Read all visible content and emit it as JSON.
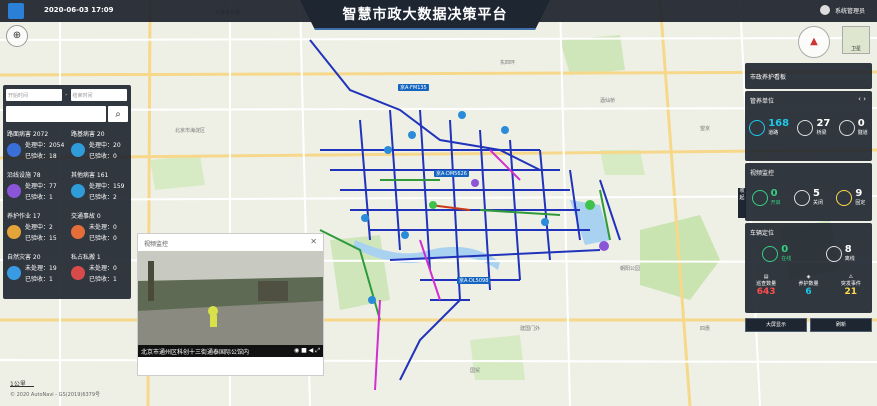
{
  "header": {
    "datetime": "2020-06-03 17:09",
    "title": "智慧市政大数据决策平台",
    "username": "系统管理员"
  },
  "filters": {
    "start_placeholder": "开始时间",
    "end_placeholder": "结束时间",
    "separator": "-"
  },
  "stats": [
    {
      "title": "路面病害 2072",
      "line1": "处理中：2054",
      "line2": "已验收：18",
      "color": "#3b6fd8"
    },
    {
      "title": "路基病害 20",
      "line1": "处理中：20",
      "line2": "已验收：0",
      "color": "#2f9bd9"
    },
    {
      "title": "沿线设施 78",
      "line1": "处理中：77",
      "line2": "已验收：1",
      "color": "#8a55d9"
    },
    {
      "title": "其他病害 161",
      "line1": "处理中：159",
      "line2": "已验收：2",
      "color": "#2f9bd9"
    },
    {
      "title": "养护作业 17",
      "line1": "处理中：2",
      "line2": "已验收：15",
      "color": "#e5a43a"
    },
    {
      "title": "交通事故 0",
      "line1": "未处理：0",
      "line2": "已验收：0",
      "color": "#e56d3a"
    },
    {
      "title": "自然灾害 20",
      "line1": "未处理：19",
      "line2": "已验收：1",
      "color": "#3a9be5"
    },
    {
      "title": "私占私搬 1",
      "line1": "未处理：0",
      "line2": "已验收：1",
      "color": "#d94b4b"
    }
  ],
  "right": {
    "board_title": "市政养护看板",
    "units": {
      "title": "管养单位",
      "items": [
        {
          "num": "168",
          "label": "道路",
          "color": "#1ec8e8"
        },
        {
          "num": "27",
          "label": "桥梁",
          "color": "#ffffff"
        },
        {
          "num": "0",
          "label": "隧道",
          "color": "#ffffff"
        }
      ]
    },
    "video": {
      "title": "视频监控",
      "items": [
        {
          "num": "0",
          "label": "开启",
          "color": "#35d07f"
        },
        {
          "num": "5",
          "label": "关闭",
          "color": "#ffffff"
        },
        {
          "num": "9",
          "label": "固定",
          "color": "#ffd84a"
        }
      ]
    },
    "vehicle": {
      "title": "车辆定位",
      "online": {
        "num": "0",
        "label": "在线",
        "color": "#35d07f"
      },
      "offline": {
        "num": "8",
        "label": "离线"
      },
      "cards": [
        {
          "label": "巡查数量",
          "num": "643",
          "color": "#ff4d4d"
        },
        {
          "label": "养护数量",
          "num": "6",
          "color": "#1ec8e8"
        },
        {
          "label": "突发事件",
          "num": "21",
          "color": "#ffd84a"
        }
      ]
    },
    "buttons": {
      "screen": "大屏显示",
      "refresh": "刷新"
    },
    "side_tab": "收起"
  },
  "popup": {
    "title": "视频监控",
    "caption": "北京市通州区科创十三街通泰国际公馆内"
  },
  "map": {
    "copyright": "© 2020 AutoNavi - GS(2019)6379号",
    "scale": "1公里",
    "labels": [
      "京A·FM135",
      "京A·DM5626",
      "京A·DL5098"
    ]
  }
}
